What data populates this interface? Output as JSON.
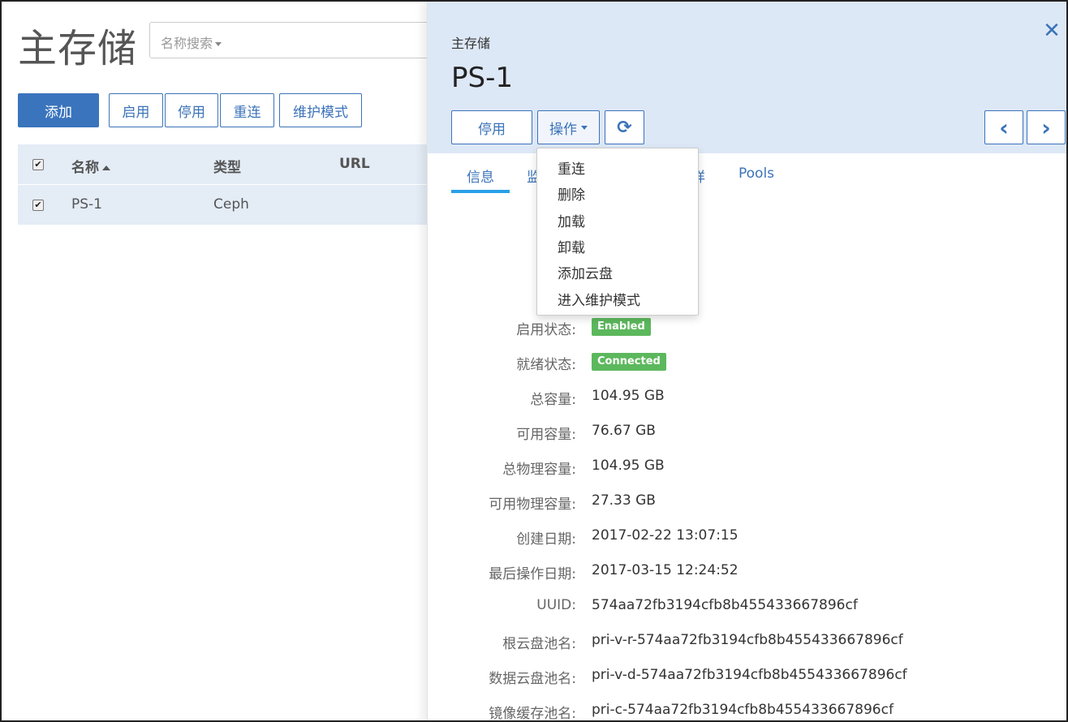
{
  "page": {
    "title": "主存储",
    "search_label": "名称搜索"
  },
  "toolbar": {
    "add_label": "添加",
    "enable_label": "启用",
    "disable_label": "停用",
    "reconnect_label": "重连",
    "maintenance_label": "维护模式"
  },
  "table": {
    "columns": [
      "名称",
      "类型",
      "URL"
    ],
    "rows": [
      {
        "name": "PS-1",
        "type": "Ceph",
        "url": ""
      }
    ]
  },
  "detail": {
    "subtitle": "主存储",
    "title": "PS-1",
    "close_glyph": "✕",
    "disable_label": "停用",
    "actions_label": "操作",
    "refresh_glyph": "⟳",
    "prev_glyph": "‹",
    "next_glyph": "›",
    "tabs": [
      "信息",
      "监",
      "详",
      "Pools"
    ],
    "menu": [
      "重连",
      "删除",
      "加载",
      "卸载",
      "添加云盘",
      "进入维护模式"
    ],
    "info": [
      {
        "label": "启用状态:",
        "badge": "Enabled"
      },
      {
        "label": "就绪状态:",
        "badge": "Connected"
      },
      {
        "label": "总容量:",
        "value": "104.95 GB"
      },
      {
        "label": "可用容量:",
        "value": "76.67 GB"
      },
      {
        "label": "总物理容量:",
        "value": "104.95 GB"
      },
      {
        "label": "可用物理容量:",
        "value": "27.33 GB"
      },
      {
        "label": "创建日期:",
        "value": "2017-02-22 13:07:15"
      },
      {
        "label": "最后操作日期:",
        "value": "2017-03-15 12:24:52"
      },
      {
        "label": "UUID:",
        "value": "574aa72fb3194cfb8b455433667896cf"
      },
      {
        "label": "根云盘池名:",
        "value": "pri-v-r-574aa72fb3194cfb8b455433667896cf"
      },
      {
        "label": "数据云盘池名:",
        "value": "pri-v-d-574aa72fb3194cfb8b455433667896cf"
      },
      {
        "label": "镜像缓存池名:",
        "value": "pri-c-574aa72fb3194cfb8b455433667896cf"
      }
    ]
  },
  "colors": {
    "primary": "#3a74bd",
    "header_bg": "#dde8f7",
    "success": "#5cb85c",
    "tab_active": "#2aa0e8"
  }
}
